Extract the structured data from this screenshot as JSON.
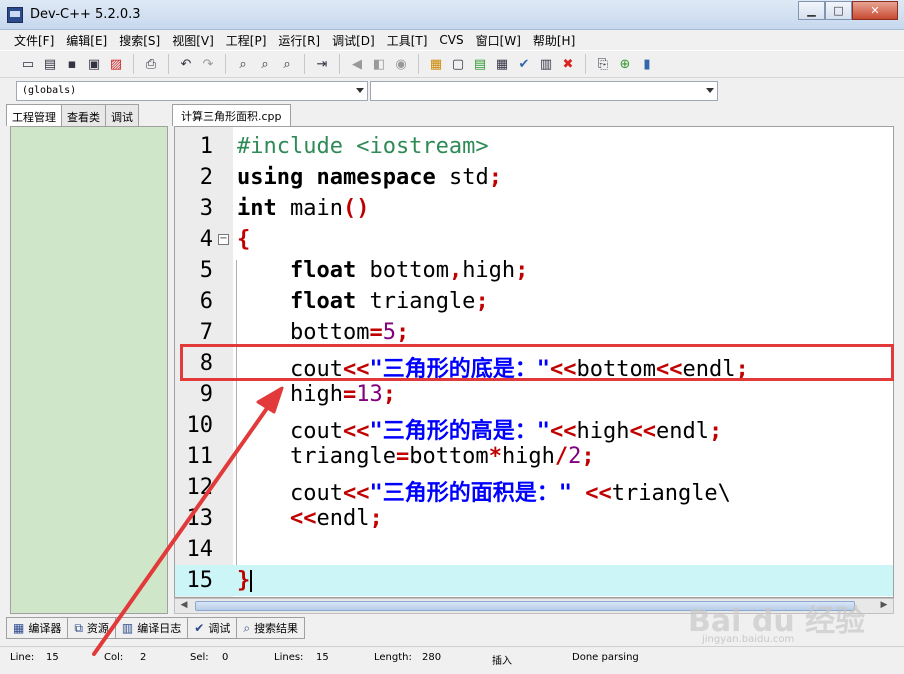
{
  "window": {
    "title": "Dev-C++ 5.2.0.3",
    "minimize": "▁",
    "maximize": "□",
    "close": "✕"
  },
  "menu": [
    "文件[F]",
    "编辑[E]",
    "搜索[S]",
    "视图[V]",
    "工程[P]",
    "运行[R]",
    "调试[D]",
    "工具[T]",
    "CVS",
    "窗口[W]",
    "帮助[H]"
  ],
  "combos": {
    "scope": "(globals)",
    "symbol": ""
  },
  "left_tabs": [
    "工程管理",
    "查看类",
    "调试"
  ],
  "editor_tab": "计算三角形面积.cpp",
  "code_lines": [
    {
      "n": "1",
      "tokens": [
        [
          "pp",
          "#include <iostream>"
        ]
      ]
    },
    {
      "n": "2",
      "tokens": [
        [
          "kw",
          "using"
        ],
        [
          "",
          " "
        ],
        [
          "kw",
          "namespace"
        ],
        [
          "",
          " std"
        ],
        [
          "op",
          ";"
        ]
      ]
    },
    {
      "n": "3",
      "tokens": [
        [
          "kw",
          "int"
        ],
        [
          "",
          " main"
        ],
        [
          "op",
          "()"
        ]
      ]
    },
    {
      "n": "4",
      "tokens": [
        [
          "op",
          "{"
        ]
      ],
      "fold": true
    },
    {
      "n": "5",
      "tokens": [
        [
          "",
          "    "
        ],
        [
          "kw",
          "float"
        ],
        [
          "",
          " bottom"
        ],
        [
          "op",
          ","
        ],
        [
          "",
          "high"
        ],
        [
          "op",
          ";"
        ]
      ]
    },
    {
      "n": "6",
      "tokens": [
        [
          "",
          "    "
        ],
        [
          "kw",
          "float"
        ],
        [
          "",
          " triangle"
        ],
        [
          "op",
          ";"
        ]
      ]
    },
    {
      "n": "7",
      "tokens": [
        [
          "",
          "    bottom"
        ],
        [
          "op",
          "="
        ],
        [
          "num",
          "5"
        ],
        [
          "op",
          ";"
        ]
      ]
    },
    {
      "n": "8",
      "tokens": [
        [
          "",
          "    cout"
        ],
        [
          "op",
          "<<"
        ],
        [
          "str",
          "\"三角形的底是：\""
        ],
        [
          "op",
          "<<"
        ],
        [
          "",
          "bottom"
        ],
        [
          "op",
          "<<"
        ],
        [
          "",
          "endl"
        ],
        [
          "op",
          ";"
        ]
      ]
    },
    {
      "n": "9",
      "tokens": [
        [
          "",
          "    high"
        ],
        [
          "op",
          "="
        ],
        [
          "num",
          "13"
        ],
        [
          "op",
          ";"
        ]
      ]
    },
    {
      "n": "10",
      "tokens": [
        [
          "",
          "    cout"
        ],
        [
          "op",
          "<<"
        ],
        [
          "str",
          "\"三角形的高是：\""
        ],
        [
          "op",
          "<<"
        ],
        [
          "",
          "high"
        ],
        [
          "op",
          "<<"
        ],
        [
          "",
          "endl"
        ],
        [
          "op",
          ";"
        ]
      ]
    },
    {
      "n": "11",
      "tokens": [
        [
          "",
          "    triangle"
        ],
        [
          "op",
          "="
        ],
        [
          "",
          "bottom"
        ],
        [
          "op",
          "*"
        ],
        [
          "",
          "high"
        ],
        [
          "op",
          "/"
        ],
        [
          "num",
          "2"
        ],
        [
          "op",
          ";"
        ]
      ]
    },
    {
      "n": "12",
      "tokens": [
        [
          "",
          "    cout"
        ],
        [
          "op",
          "<<"
        ],
        [
          "str",
          "\"三角形的面积是：\""
        ],
        [
          "",
          " "
        ],
        [
          "op",
          "<<"
        ],
        [
          "",
          "triangle\\"
        ]
      ]
    },
    {
      "n": "13",
      "tokens": [
        [
          "",
          "    "
        ],
        [
          "op",
          "<<"
        ],
        [
          "",
          "endl"
        ],
        [
          "op",
          ";"
        ]
      ]
    },
    {
      "n": "14",
      "tokens": []
    },
    {
      "n": "15",
      "tokens": [
        [
          "op",
          "}"
        ]
      ],
      "caret": true,
      "highlight": true
    }
  ],
  "bottom_tabs": [
    {
      "icon": "compiler-icon",
      "glyph": "▦",
      "label": "编译器"
    },
    {
      "icon": "resources-icon",
      "glyph": "⧉",
      "label": "资源"
    },
    {
      "icon": "compile-log-icon",
      "glyph": "▥",
      "label": "编译日志"
    },
    {
      "icon": "debug-icon",
      "glyph": "✔",
      "label": "调试"
    },
    {
      "icon": "search-results-icon",
      "glyph": "⌕",
      "label": "搜索结果"
    }
  ],
  "status": {
    "line_label": "Line:",
    "line": "15",
    "col_label": "Col:",
    "col": "2",
    "sel_label": "Sel:",
    "sel": "0",
    "lines_label": "Lines:",
    "lines": "15",
    "length_label": "Length:",
    "length": "280",
    "mode": "插入",
    "message": "Done parsing"
  },
  "watermark": {
    "brand": "Bai du 经验",
    "sub": "jingyan.baidu.com"
  },
  "colors": {
    "highlight_box": "#e23a3a",
    "current_line": "#cbf5f6",
    "left_panel": "#cfe6c9"
  }
}
